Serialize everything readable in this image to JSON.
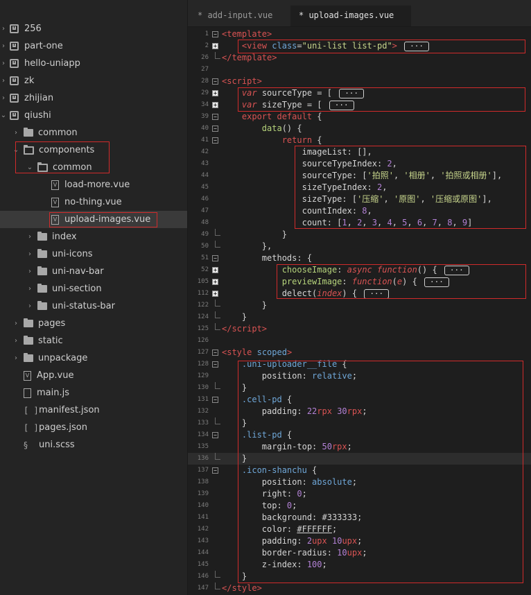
{
  "sidebar": {
    "items": [
      {
        "label": "256",
        "type": "project",
        "indent": 0,
        "expanded": false
      },
      {
        "label": "part-one",
        "type": "project",
        "indent": 0,
        "expanded": false
      },
      {
        "label": "hello-uniapp",
        "type": "project",
        "indent": 0,
        "expanded": false
      },
      {
        "label": "zk",
        "type": "project",
        "indent": 0,
        "expanded": false
      },
      {
        "label": "zhijian",
        "type": "project",
        "indent": 0,
        "expanded": false
      },
      {
        "label": "qiushi",
        "type": "project",
        "indent": 0,
        "expanded": true
      },
      {
        "label": "common",
        "type": "folder",
        "indent": 1,
        "expanded": false
      },
      {
        "label": "components",
        "type": "folder",
        "indent": 1,
        "expanded": true
      },
      {
        "label": "common",
        "type": "folder",
        "indent": 2,
        "expanded": true
      },
      {
        "label": "load-more.vue",
        "type": "vue",
        "indent": 3
      },
      {
        "label": "no-thing.vue",
        "type": "vue",
        "indent": 3
      },
      {
        "label": "upload-images.vue",
        "type": "vue",
        "indent": 3,
        "selected": true
      },
      {
        "label": "index",
        "type": "folder",
        "indent": 2,
        "expanded": false
      },
      {
        "label": "uni-icons",
        "type": "folder",
        "indent": 2,
        "expanded": false
      },
      {
        "label": "uni-nav-bar",
        "type": "folder",
        "indent": 2,
        "expanded": false
      },
      {
        "label": "uni-section",
        "type": "folder",
        "indent": 2,
        "expanded": false
      },
      {
        "label": "uni-status-bar",
        "type": "folder",
        "indent": 2,
        "expanded": false
      },
      {
        "label": "pages",
        "type": "folder",
        "indent": 1,
        "expanded": false
      },
      {
        "label": "static",
        "type": "folder",
        "indent": 1,
        "expanded": false
      },
      {
        "label": "unpackage",
        "type": "folder",
        "indent": 1,
        "expanded": false
      },
      {
        "label": "App.vue",
        "type": "vue",
        "indent": 1
      },
      {
        "label": "main.js",
        "type": "js",
        "indent": 1
      },
      {
        "label": "manifest.json",
        "type": "json",
        "indent": 1
      },
      {
        "label": "pages.json",
        "type": "json",
        "indent": 1
      },
      {
        "label": "uni.scss",
        "type": "scss",
        "indent": 1
      }
    ]
  },
  "tabs": [
    {
      "label": "* add-input.vue",
      "active": false
    },
    {
      "label": "* upload-images.vue",
      "active": true
    }
  ],
  "code_lines": [
    {
      "n": "1",
      "fold": "minus",
      "html": "<span class=\"tag\">&lt;template&gt;</span>"
    },
    {
      "n": "2",
      "fold": "plus",
      "html": "    <span class=\"tag\">&lt;view</span> <span class=\"attr\">class</span>=<span class=\"str\">\"uni-list list-pd\"</span><span class=\"tag\">&gt;</span> <span class=\"dots\">&middot;&middot;&middot;</span>"
    },
    {
      "n": "26",
      "fold": "end",
      "html": "<span class=\"tag\">&lt;/template&gt;</span>"
    },
    {
      "n": "27",
      "fold": "",
      "html": ""
    },
    {
      "n": "28",
      "fold": "minus",
      "html": "<span class=\"tag\">&lt;script&gt;</span>"
    },
    {
      "n": "29",
      "fold": "plus",
      "html": "    <span class=\"kwi\">var</span> sourceType = [ <span class=\"dots\">&middot;&middot;&middot;</span>"
    },
    {
      "n": "34",
      "fold": "plus",
      "html": "    <span class=\"kwi\">var</span> sizeType = [ <span class=\"dots\">&middot;&middot;&middot;</span>"
    },
    {
      "n": "39",
      "fold": "minus",
      "html": "    <span class=\"kw\">export default</span> {"
    },
    {
      "n": "40",
      "fold": "minus",
      "html": "        <span class=\"fn\">data</span>() {"
    },
    {
      "n": "41",
      "fold": "minus",
      "html": "            <span class=\"kw\">return</span> {"
    },
    {
      "n": "42",
      "fold": "",
      "html": "                imageList: [],"
    },
    {
      "n": "43",
      "fold": "",
      "html": "                sourceTypeIndex: <span class=\"num\">2</span>,"
    },
    {
      "n": "44",
      "fold": "",
      "html": "                sourceType: [<span class=\"str\">'拍照'</span>, <span class=\"str\">'相册'</span>, <span class=\"str\">'拍照或相册'</span>],"
    },
    {
      "n": "45",
      "fold": "",
      "html": "                sizeTypeIndex: <span class=\"num\">2</span>,"
    },
    {
      "n": "46",
      "fold": "",
      "html": "                sizeType: [<span class=\"str\">'压缩'</span>, <span class=\"str\">'原图'</span>, <span class=\"str\">'压缩或原图'</span>],"
    },
    {
      "n": "47",
      "fold": "",
      "html": "                countIndex: <span class=\"num\">8</span>,"
    },
    {
      "n": "48",
      "fold": "",
      "html": "                count: [<span class=\"num\">1</span>, <span class=\"num\">2</span>, <span class=\"num\">3</span>, <span class=\"num\">4</span>, <span class=\"num\">5</span>, <span class=\"num\">6</span>, <span class=\"num\">7</span>, <span class=\"num\">8</span>, <span class=\"num\">9</span>]"
    },
    {
      "n": "49",
      "fold": "end",
      "html": "            }"
    },
    {
      "n": "50",
      "fold": "end",
      "html": "        },"
    },
    {
      "n": "51",
      "fold": "minus",
      "html": "        methods: {"
    },
    {
      "n": "52",
      "fold": "plus",
      "html": "            <span class=\"fn\">chooseImage</span>: <span class=\"kwi\">async</span> <span class=\"kwi\">function</span>() { <span class=\"dots\">&middot;&middot;&middot;</span>"
    },
    {
      "n": "105",
      "fold": "plus",
      "html": "            <span class=\"fn\">previewImage</span>: <span class=\"kwi\">function</span>(<span class=\"param\">e</span>) { <span class=\"dots\">&middot;&middot;&middot;</span>"
    },
    {
      "n": "112",
      "fold": "plus",
      "html": "            delect(<span class=\"param\">index</span>) { <span class=\"dots\">&middot;&middot;&middot;</span>"
    },
    {
      "n": "122",
      "fold": "end",
      "html": "        }"
    },
    {
      "n": "124",
      "fold": "end",
      "html": "    }"
    },
    {
      "n": "125",
      "fold": "end",
      "html": "<span class=\"tag\">&lt;/script&gt;</span>"
    },
    {
      "n": "126",
      "fold": "",
      "html": ""
    },
    {
      "n": "127",
      "fold": "minus",
      "html": "<span class=\"tag\">&lt;style</span> <span class=\"attr\">scoped</span><span class=\"tag\">&gt;</span>"
    },
    {
      "n": "128",
      "fold": "minus",
      "html": "    <span class=\"sel\">.uni-uploader__file</span> {"
    },
    {
      "n": "129",
      "fold": "",
      "html": "        position: <span class=\"val\">relative</span>;"
    },
    {
      "n": "130",
      "fold": "end",
      "html": "    }"
    },
    {
      "n": "131",
      "fold": "minus",
      "html": "    <span class=\"sel\">.cell-pd</span> {"
    },
    {
      "n": "132",
      "fold": "",
      "html": "        padding: <span class=\"num\">22</span><span class=\"unit\">rpx</span> <span class=\"num\">30</span><span class=\"unit\">rpx</span>;"
    },
    {
      "n": "133",
      "fold": "end",
      "html": "    }"
    },
    {
      "n": "134",
      "fold": "minus",
      "html": "    <span class=\"sel\">.list-pd</span> {"
    },
    {
      "n": "135",
      "fold": "",
      "html": "        margin-top: <span class=\"num\">50</span><span class=\"unit\">rpx</span>;"
    },
    {
      "n": "136",
      "fold": "end",
      "html": "    }",
      "current": true
    },
    {
      "n": "137",
      "fold": "minus",
      "html": "    <span class=\"sel\">.icon-shanchu</span> {"
    },
    {
      "n": "138",
      "fold": "",
      "html": "        position: <span class=\"val\">absolute</span>;"
    },
    {
      "n": "139",
      "fold": "",
      "html": "        right: <span class=\"num\">0</span>;"
    },
    {
      "n": "140",
      "fold": "",
      "html": "        top: <span class=\"num\">0</span>;"
    },
    {
      "n": "141",
      "fold": "",
      "html": "        background: #333333;"
    },
    {
      "n": "142",
      "fold": "",
      "html": "        color: <u>#FFFFFF</u>;"
    },
    {
      "n": "143",
      "fold": "",
      "html": "        padding: <span class=\"num\">2</span><span class=\"unit\">upx</span> <span class=\"num\">10</span><span class=\"unit\">upx</span>;"
    },
    {
      "n": "144",
      "fold": "",
      "html": "        border-radius: <span class=\"num\">10</span><span class=\"unit\">upx</span>;"
    },
    {
      "n": "145",
      "fold": "",
      "html": "        z-index: <span class=\"num\">100</span>;"
    },
    {
      "n": "146",
      "fold": "end",
      "html": "    }"
    },
    {
      "n": "147",
      "fold": "end",
      "html": "<span class=\"tag\">&lt;/style&gt;</span>"
    }
  ]
}
